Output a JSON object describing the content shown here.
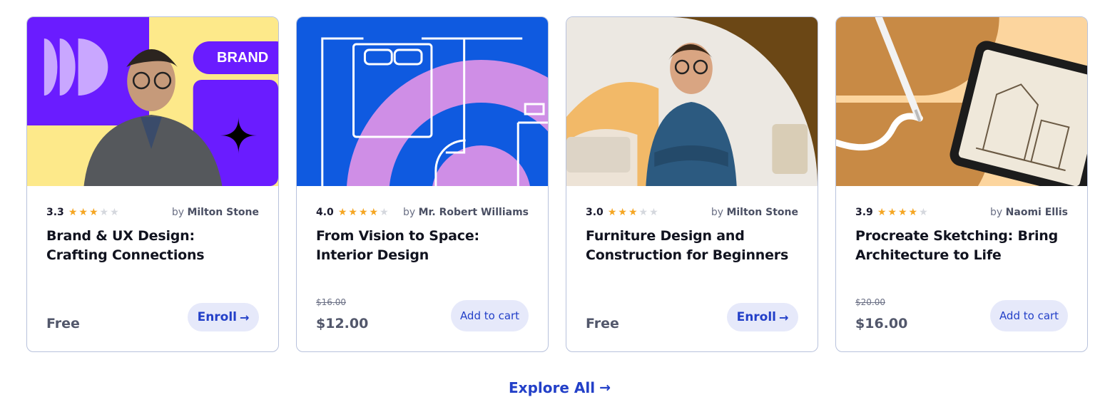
{
  "colors": {
    "accent": "#2340c8",
    "star": "#f5a623",
    "button_bg": "#e6e9fa"
  },
  "courses": [
    {
      "rating": "3.3",
      "stars": 3,
      "by": "by",
      "author": "Milton Stone",
      "title": "Brand & UX Design: Crafting Connections",
      "old_price": "",
      "price": "Free",
      "action": "Enroll",
      "action_icon": "arrow-right-icon",
      "thumb_text": "BRAND"
    },
    {
      "rating": "4.0",
      "stars": 4,
      "by": "by",
      "author": "Mr. Robert Williams",
      "title": "From Vision to Space: Interior Design",
      "old_price": "$16.00",
      "price": "$12.00",
      "action": "Add to cart"
    },
    {
      "rating": "3.0",
      "stars": 3,
      "by": "by",
      "author": "Milton Stone",
      "title": "Furniture Design and Construction for Beginners",
      "old_price": "",
      "price": "Free",
      "action": "Enroll",
      "action_icon": "arrow-right-icon"
    },
    {
      "rating": "3.9",
      "stars": 4,
      "by": "by",
      "author": "Naomi Ellis",
      "title": "Procreate Sketching: Bring Architecture to Life",
      "old_price": "$20.00",
      "price": "$16.00",
      "action": "Add to cart"
    }
  ],
  "explore": {
    "label": "Explore All",
    "icon": "arrow-right-icon"
  }
}
